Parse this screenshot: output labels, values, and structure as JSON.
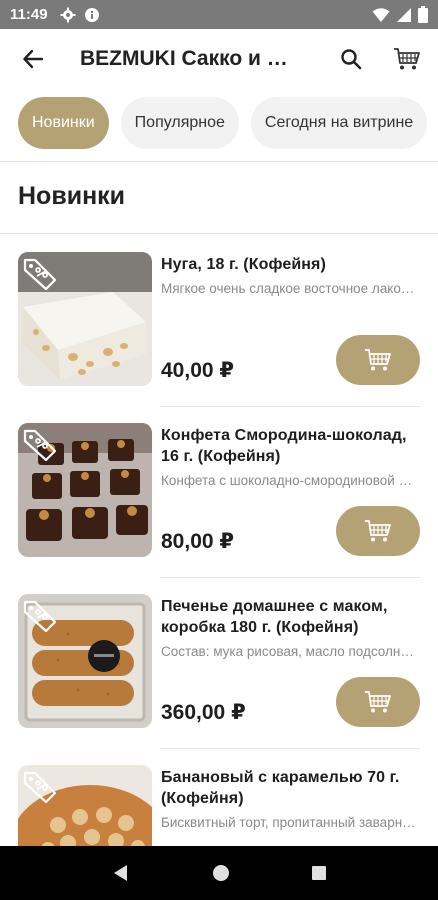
{
  "status_bar": {
    "time": "11:49",
    "icons": [
      "gear-icon",
      "info-icon",
      "wifi-icon",
      "signal-icon",
      "battery-icon"
    ]
  },
  "app_bar": {
    "title": "BEZMUKI Сакко и Ванцетти",
    "icons": [
      "back-arrow-icon",
      "search-icon",
      "cart-icon"
    ]
  },
  "chips": [
    {
      "label": "Новинки",
      "active": true
    },
    {
      "label": "Популярное",
      "active": false
    },
    {
      "label": "Сегодня на витрине",
      "active": false
    }
  ],
  "section_title": "Новинки",
  "products": [
    {
      "name": "Нуга, 18 г. (Кофейня)",
      "description": "Мягкое очень сладкое восточное лакомство",
      "price": "40,00 ₽"
    },
    {
      "name": "Конфета Смородина-шоколад, 16 г. (Кофейня)",
      "description": "Конфета с шоколадно-смородиновой начинкой",
      "price": "80,00 ₽"
    },
    {
      "name": "Печенье домашнее с маком, коробка 180 г. (Кофейня)",
      "description": "Состав:   мука рисовая, масло подсолнечное",
      "price": "360,00 ₽"
    },
    {
      "name": "Банановый с карамелью 70 г. (Кофейня)",
      "description": "Бисквитный торт, пропитанный заварным кремом",
      "price": ""
    }
  ],
  "colors": {
    "accent": "#b5a274",
    "status_bar": "#7a7a7a",
    "nav_bar": "#000000"
  },
  "nav_bar": {
    "icons": [
      "back-triangle-icon",
      "home-circle-icon",
      "recents-square-icon"
    ]
  }
}
